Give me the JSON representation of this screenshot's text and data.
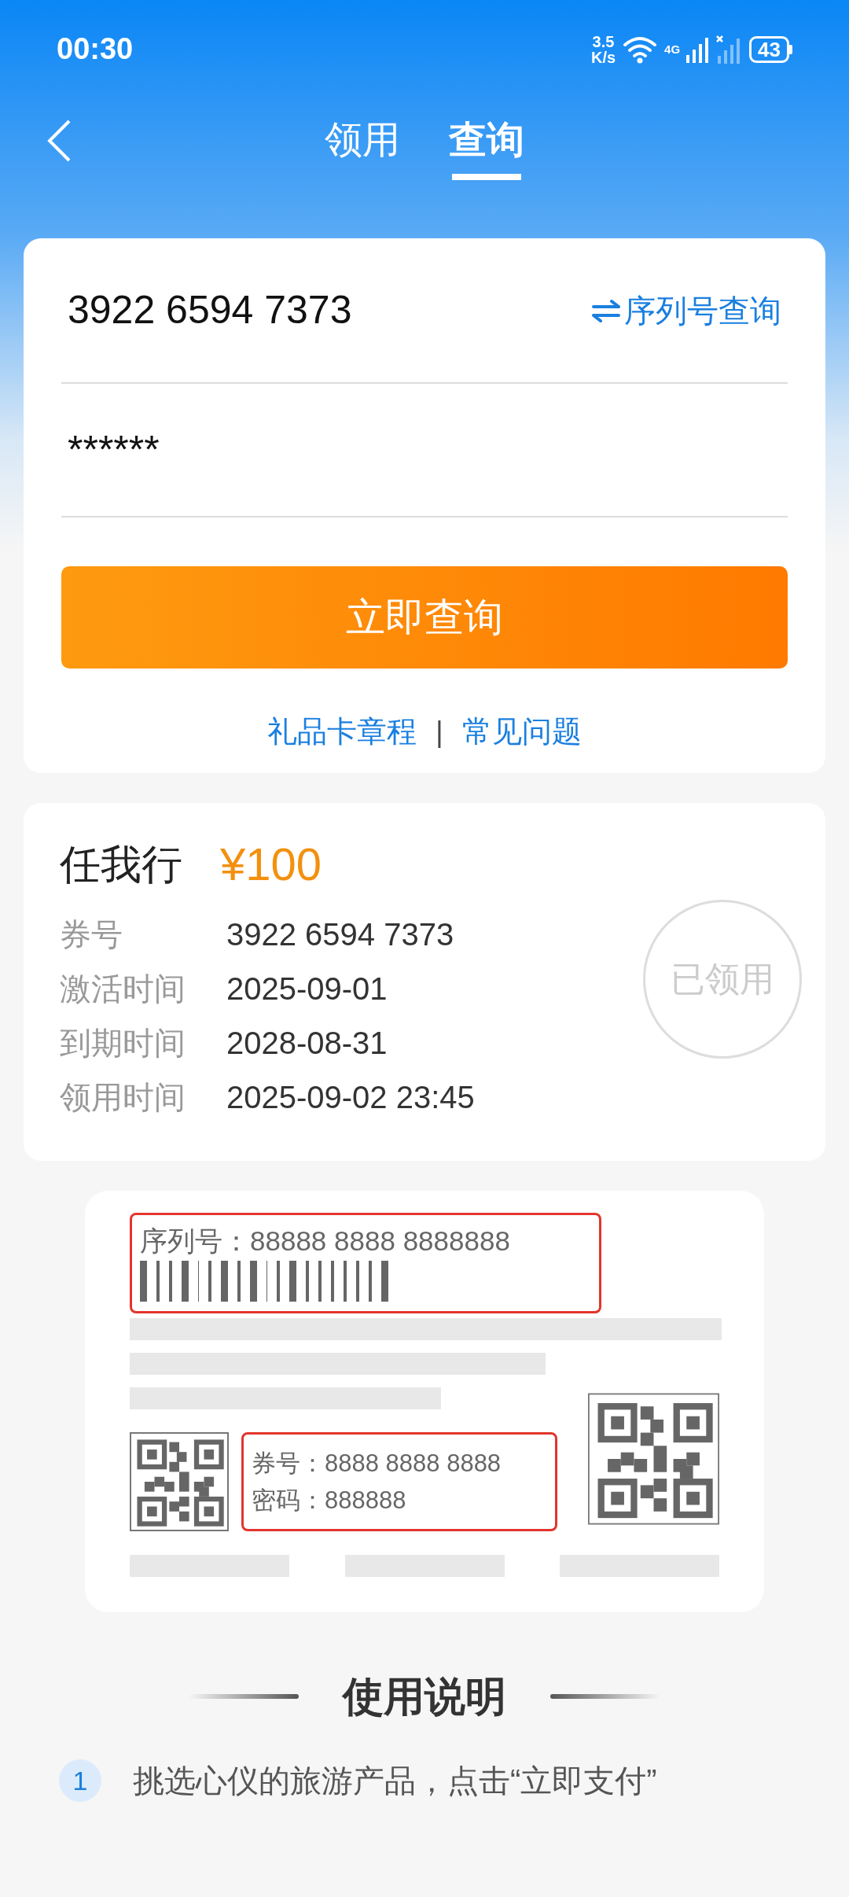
{
  "status_bar": {
    "time": "00:30",
    "speed_value": "3.5",
    "speed_unit": "K/s",
    "network": "4G",
    "battery": "43"
  },
  "tabs": [
    {
      "label": "领用",
      "selected": false
    },
    {
      "label": "查询",
      "selected": true
    }
  ],
  "query_form": {
    "card_number": "3922 6594 7373",
    "switch_link": "序列号查询",
    "password": "******",
    "submit": "立即查询",
    "links": [
      "礼品卡章程",
      "常见问题"
    ],
    "separator": "|"
  },
  "card_result": {
    "name": "任我行",
    "amount": "¥100",
    "stamp": "已领用",
    "fields": [
      {
        "label": "券号",
        "value": "3922 6594 7373"
      },
      {
        "label": "激活时间",
        "value": "2025-09-01"
      },
      {
        "label": "到期时间",
        "value": "2028-08-31"
      },
      {
        "label": "领用时间",
        "value": "2025-09-02 23:45"
      }
    ]
  },
  "sample_card": {
    "serial_label": "序列号：",
    "serial_value": "88888 8888 8888888",
    "voucher_label": "券号：",
    "voucher_value": "8888 8888 8888",
    "password_label": "密码：",
    "password_value": "888888"
  },
  "instructions": {
    "title": "使用说明",
    "steps": [
      {
        "number": "1",
        "text": "挑选心仪的旅游产品，点击“立即支付”"
      }
    ]
  }
}
